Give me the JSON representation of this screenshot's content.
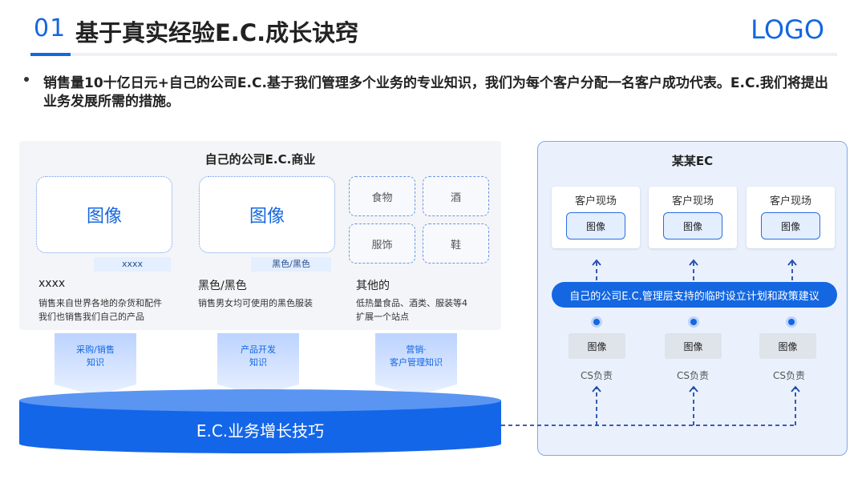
{
  "header": {
    "number": "01",
    "title": "基于真实经验E.C.成长诀窍",
    "logo": "LOGO"
  },
  "intro": {
    "text": "销售量10十亿日元+自己的公司E.C.基于我们管理多个业务的专业知识，我们为每个客户分配一名客户成功代表。E.C.我们将提出业务发展所需的措施。"
  },
  "left_section": {
    "title": "自己的公司E.C.商业",
    "categories": [
      {
        "image_label": "图像",
        "tag": "xxxx",
        "title": "xxxx",
        "desc_line1": "销售来自世界各地的杂货和配件",
        "desc_line2": "我们也销售我们自己的产品"
      },
      {
        "image_label": "图像",
        "tag": "黑色/黑色",
        "title": "黑色/黑色",
        "desc_line1": "销售男女均可使用的黑色服装",
        "desc_line2": ""
      },
      {
        "title": "其他的",
        "desc_line1": "低热量食品、酒类、服装等4",
        "desc_line2": "扩展一个站点"
      }
    ],
    "small_boxes": [
      "食物",
      "酒",
      "服饰",
      "鞋"
    ],
    "knowledge": [
      {
        "line1": "采购/销售",
        "line2": "知识"
      },
      {
        "line1": "产品开发",
        "line2": "知识"
      },
      {
        "line1": "营销·",
        "line2": "客户管理知识"
      }
    ],
    "base_label": "E.C.业务增长技巧"
  },
  "right_section": {
    "title": "某某EC",
    "sites": [
      {
        "label": "客户现场",
        "image": "图像"
      },
      {
        "label": "客户现场",
        "image": "图像"
      },
      {
        "label": "客户现场",
        "image": "图像"
      }
    ],
    "support_label": "自己的公司E.C.管理层支持的临时设立计划和政策建议",
    "cs": [
      {
        "image": "图像",
        "label": "CS负责"
      },
      {
        "image": "图像",
        "label": "CS负责"
      },
      {
        "image": "图像",
        "label": "CS负责"
      }
    ]
  },
  "colors": {
    "accent": "#1467e0",
    "panel_bg": "#f4f5f8",
    "right_bg": "#eaf1fd",
    "cylinder": "#1466e8"
  }
}
